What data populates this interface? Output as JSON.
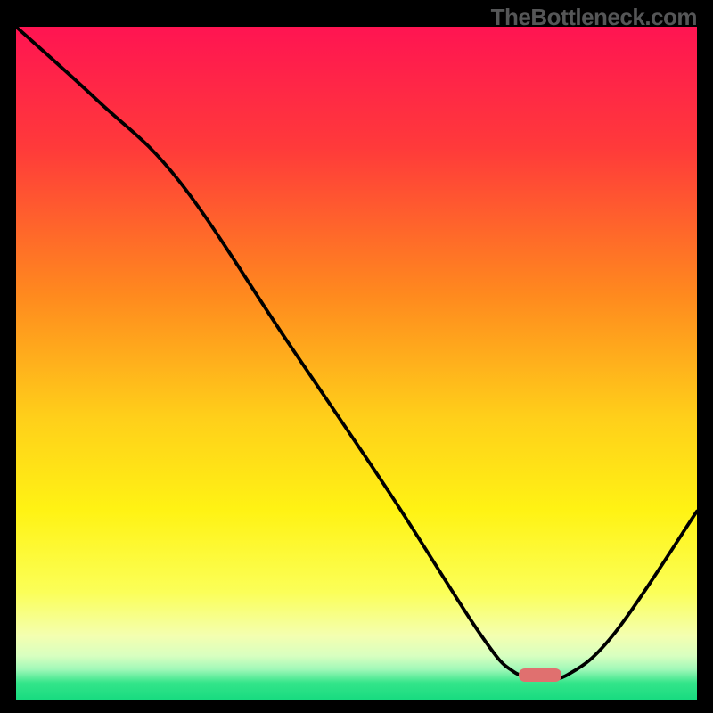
{
  "watermark": "TheBottleneck.com",
  "colors": {
    "frame": "#000000",
    "watermark": "#555657",
    "curve": "#000000",
    "bump": "#e0706f",
    "gradient_stops": [
      {
        "offset": 0.0,
        "color": "#ff1452"
      },
      {
        "offset": 0.18,
        "color": "#ff3a3a"
      },
      {
        "offset": 0.4,
        "color": "#ff8a1e"
      },
      {
        "offset": 0.58,
        "color": "#ffcf1a"
      },
      {
        "offset": 0.72,
        "color": "#fff314"
      },
      {
        "offset": 0.84,
        "color": "#fbff58"
      },
      {
        "offset": 0.905,
        "color": "#f4ffb0"
      },
      {
        "offset": 0.935,
        "color": "#d8ffc0"
      },
      {
        "offset": 0.955,
        "color": "#a0f8b8"
      },
      {
        "offset": 0.975,
        "color": "#34e58a"
      },
      {
        "offset": 1.0,
        "color": "#18db80"
      }
    ]
  },
  "chart_data": {
    "type": "line",
    "title": "",
    "xlabel": "",
    "ylabel": "",
    "x_range": [
      0,
      100
    ],
    "y_range": [
      0,
      100
    ],
    "comment": "Single black curve over vertical red→green gradient. Values are approximate pixel-read percentages of the plot box. Higher y = higher on screen. Curve descends from top-left, inflects ~x=24, drops to a flat valley ~x=73–81, then rises to the right edge.",
    "series": [
      {
        "name": "bottleneck-curve",
        "points": [
          {
            "x": 0,
            "y": 100
          },
          {
            "x": 12,
            "y": 89
          },
          {
            "x": 24,
            "y": 77
          },
          {
            "x": 40,
            "y": 53
          },
          {
            "x": 55,
            "y": 30.5
          },
          {
            "x": 68,
            "y": 10
          },
          {
            "x": 73,
            "y": 4.2
          },
          {
            "x": 77,
            "y": 3.5
          },
          {
            "x": 81,
            "y": 3.7
          },
          {
            "x": 88,
            "y": 10
          },
          {
            "x": 100,
            "y": 28
          }
        ]
      }
    ],
    "marker": {
      "name": "valley-marker",
      "x": 77,
      "y": 3.7
    }
  }
}
